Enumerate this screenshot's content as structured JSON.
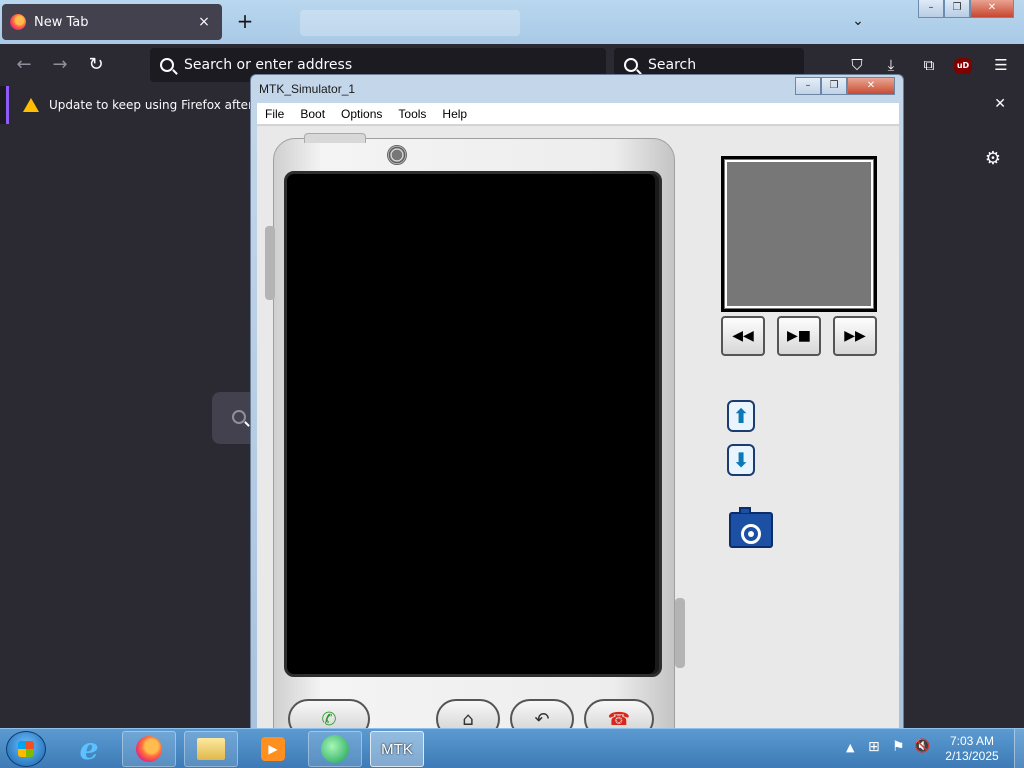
{
  "firefox": {
    "tab_title": "New Tab",
    "tab_close": "×",
    "new_tab": "+",
    "tab_list": "⌄",
    "window_controls": {
      "minimize": "–",
      "restore": "❐",
      "close": "✕"
    },
    "nav": {
      "back": "←",
      "forward": "→",
      "reload": "↻"
    },
    "url_placeholder": "Search or enter address",
    "search_placeholder": "Search",
    "toolbar_icons": {
      "pocket": "⛉",
      "downloads": "⤓",
      "extensions": "⧉",
      "ublock": "uD",
      "menu": "☰"
    },
    "notification": {
      "text": "Update to keep using Firefox after Marc",
      "close": "✕"
    },
    "settings_gear": "⚙"
  },
  "mtk": {
    "title": "MTK_Simulator_1",
    "controls": {
      "minimize": "–",
      "restore": "❐",
      "close": "✕"
    },
    "menu": [
      "File",
      "Boot",
      "Options",
      "Tools",
      "Help"
    ],
    "phone_keys": {
      "call": "✆",
      "home": "⌂",
      "back": "↶",
      "end": "☎"
    },
    "media_buttons": {
      "rewind": "◀◀",
      "play_stop": "▶■",
      "fast_forward": "▶▶"
    },
    "arrows": {
      "up": "⬆",
      "down": "⬇"
    },
    "colors": {
      "call_green": "#2e9b2e",
      "end_red": "#d8271b",
      "camera_blue": "#1c50a5"
    }
  },
  "taskbar": {
    "apps": [
      "Internet Explorer",
      "Firefox",
      "Windows Explorer",
      "Media Player",
      "Globe App",
      "MTK"
    ],
    "mtk_label": "MTK",
    "tray": {
      "show_hidden": "▲",
      "network": "⊞",
      "flag": "⚑",
      "volume": "🔇"
    },
    "clock": {
      "time": "7:03 AM",
      "date": "2/13/2025"
    }
  }
}
